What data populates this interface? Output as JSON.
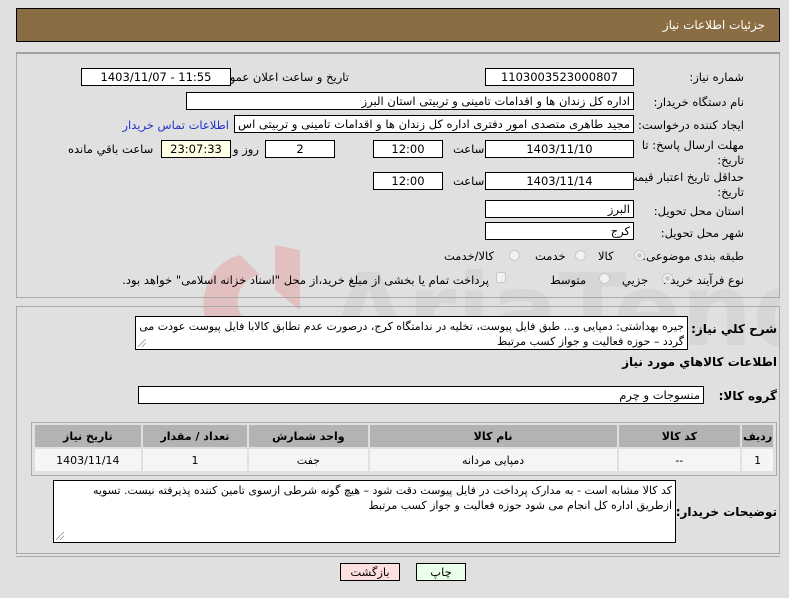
{
  "header": {
    "title": "جزئیات اطلاعات نیاز"
  },
  "form": {
    "need_number": {
      "label": "شماره نیاز:",
      "value": "1103003523000807"
    },
    "announce_datetime": {
      "label": "تاریخ و ساعت اعلان عمومی:",
      "value": "1403/11/07 - 11:55"
    },
    "buyer_org": {
      "label": "نام دستگاه خریدار:",
      "value": "اداره کل زندان ها و اقدامات تامینی و تربیتی استان البرز"
    },
    "requester": {
      "label": "ایجاد کننده درخواست:",
      "value": "مجید طاهری متصدی امور دفتری اداره کل زندان ها و اقدامات تامینی و تربیتی اس"
    },
    "buyer_contact_link": "اطلاعات تماس خریدار",
    "reply_deadline": {
      "label": "مهلت ارسال پاسخ: تا تاریخ:",
      "date": "1403/11/10",
      "time_label": "ساعت",
      "time": "12:00",
      "days": "2",
      "days_label": "روز و",
      "remaining": "23:07:33",
      "remaining_label": "ساعت باقي مانده"
    },
    "price_validity": {
      "label": "حداقل تاریخ اعتبار قیمت: تا تاریخ:",
      "date": "1403/11/14",
      "time_label": "ساعت",
      "time": "12:00"
    },
    "delivery_province": {
      "label": "استان محل تحویل:",
      "value": "البرز"
    },
    "delivery_city": {
      "label": "شهر محل تحویل:",
      "value": "کرج"
    },
    "category": {
      "label": "طبقه بندی موضوعی:",
      "options": [
        "کالا",
        "خدمت",
        "کالا/خدمت"
      ],
      "selected": "کالا"
    },
    "purchase_type": {
      "label": "نوع فرآیند خرید :",
      "options": [
        "جزیي",
        "متوسط"
      ],
      "selected": "جزیي",
      "treasury_checkbox_label": "پرداخت تمام یا بخشی از مبلغ خرید،از محل \"اسناد خزانه اسلامی\" خواهد بود.",
      "treasury_checked": false
    }
  },
  "description": {
    "label": "شرح کلي نياز:",
    "value": "جیره بهداشتی: دمپایی و... طبق فایل پیوست، تخلیه در ندامتگاه کرج، درصورت عدم تطابق کالابا فایل پیوست عودت می گردد – حوزه فعالیت و جواز کسب مرتبط"
  },
  "goods": {
    "section_title": "اطلاعات کالاهاي مورد نياز",
    "group_label": "گروه کالا:",
    "group_value": "منسوجات و چرم",
    "columns": [
      "ردیف",
      "کد کالا",
      "نام کالا",
      "واحد شمارش",
      "تعداد / مقدار",
      "تاریخ نیاز"
    ],
    "rows": [
      [
        "1",
        "--",
        "دمپایی مردانه",
        "جفت",
        "1",
        "1403/11/14"
      ]
    ]
  },
  "buyer_notes": {
    "label": "توضیحات خریدار:",
    "value": "کد کالا مشابه است - به مدارک پرداخت در فایل پیوست دقت شود – هیچ گونه شرطی ازسوی تامین کننده پذیرفته نیست. تسویه ازطریق اداره کل انجام می شود حوزه فعالیت و جواز کسب مرتبط"
  },
  "buttons": {
    "print": "چاپ",
    "back": "بازگشت"
  },
  "colors": {
    "header": "#8b6d43",
    "link": "#2233cc",
    "print_bg": "#eaffea",
    "back_bg": "#ffe0e0"
  }
}
